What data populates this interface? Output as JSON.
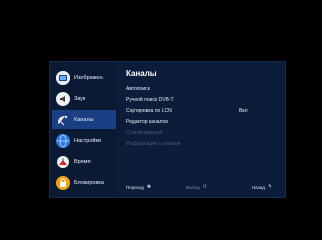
{
  "sidebar": {
    "items": [
      {
        "label": "Изображен.",
        "icon": "picture-icon",
        "active": false
      },
      {
        "label": "Звук",
        "icon": "sound-icon",
        "active": false
      },
      {
        "label": "Каналы",
        "icon": "satellite-dish-icon",
        "active": true
      },
      {
        "label": "Настройки",
        "icon": "settings-globe-icon",
        "active": false
      },
      {
        "label": "Время",
        "icon": "clock-icon",
        "active": false
      },
      {
        "label": "Блокировка",
        "icon": "lock-icon",
        "active": false
      }
    ]
  },
  "main": {
    "title": "Каналы",
    "rows": [
      {
        "label": "Автопоиск",
        "value": "",
        "disabled": false
      },
      {
        "label": "Ручной поиск DVB-T",
        "value": "",
        "disabled": false
      },
      {
        "label": "Сортировка по LCN",
        "value": "Вкл",
        "disabled": false
      },
      {
        "label": "Редактор каналов",
        "value": "",
        "disabled": false
      },
      {
        "label": "CI информация",
        "value": "",
        "disabled": true
      },
      {
        "label": "Информация о сигнале",
        "value": "",
        "disabled": true
      }
    ]
  },
  "footer": {
    "move_label": "Переход",
    "select_label": "Выбор",
    "select_key": "И",
    "back_label": "Назад"
  },
  "colors": {
    "panel_bg": "#0b1d3a",
    "active_item": "#1a3f85",
    "disabled_text": "#4a5b7e"
  }
}
